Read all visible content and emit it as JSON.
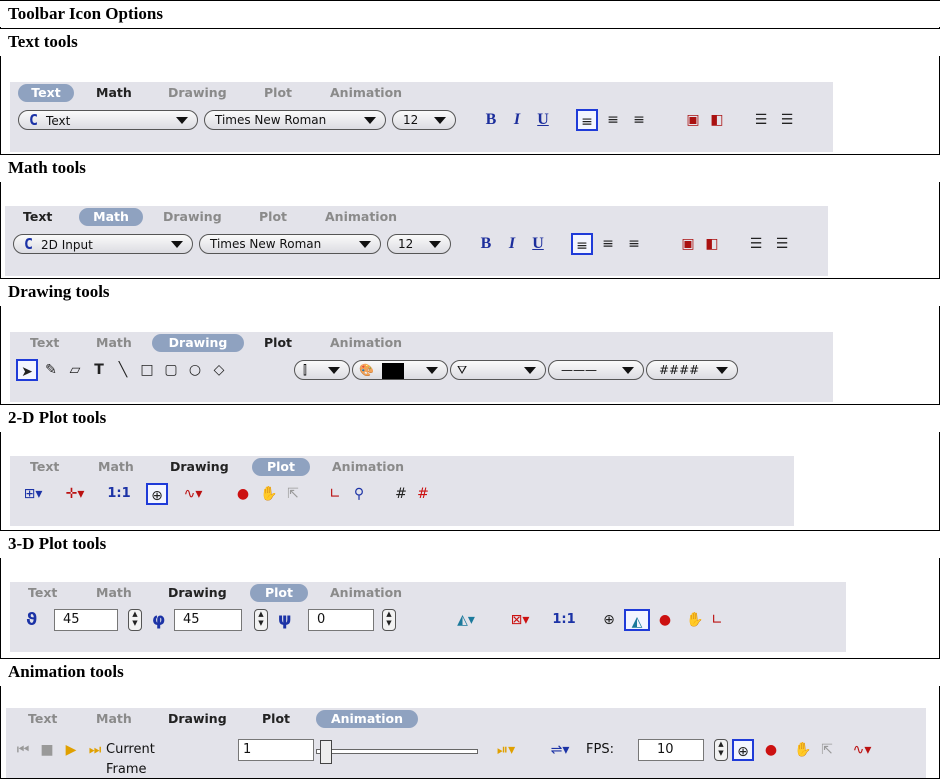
{
  "headers": {
    "title": "Toolbar Icon Options",
    "text": "Text tools",
    "math": "Math tools",
    "drawing": "Drawing tools",
    "plot2d": "2-D Plot tools",
    "plot3d": "3-D Plot tools",
    "animation": "Animation tools"
  },
  "tabs": [
    "Text",
    "Math",
    "Drawing",
    "Plot",
    "Animation"
  ],
  "text_toolbar": {
    "mode": "Text",
    "font": "Times New Roman",
    "size": "12"
  },
  "math_toolbar": {
    "mode": "2D Input",
    "font": "Times New Roman",
    "size": "12"
  },
  "format": {
    "bold": "B",
    "italic": "I",
    "underline": "U",
    "mode_glyph": "C"
  },
  "plot2d": {
    "scale": "1:1"
  },
  "plot3d": {
    "theta": "45",
    "phi": "45",
    "psi": "0",
    "scale": "1:1",
    "theta_sym": "ϑ",
    "phi_sym": "φ",
    "psi_sym": "ψ"
  },
  "animation": {
    "current_frame_label": "Current Frame",
    "current_frame": "1",
    "fps_label": "FPS:",
    "fps": "10"
  },
  "colors": {
    "active_tab": "#8fa2c0",
    "toolbar_bg": "#e3e3ea",
    "selection": "#1f3bd8"
  },
  "icons": [
    "pointer-icon",
    "pencil-icon",
    "eraser-icon",
    "text-box-icon",
    "line-icon",
    "rectangle-icon",
    "rounded-rect-icon",
    "circle-icon",
    "diamond-icon",
    "grid-icon",
    "axes-icon",
    "pan-icon",
    "rotate-icon",
    "zoom-icon",
    "play-icon",
    "stop-icon"
  ]
}
